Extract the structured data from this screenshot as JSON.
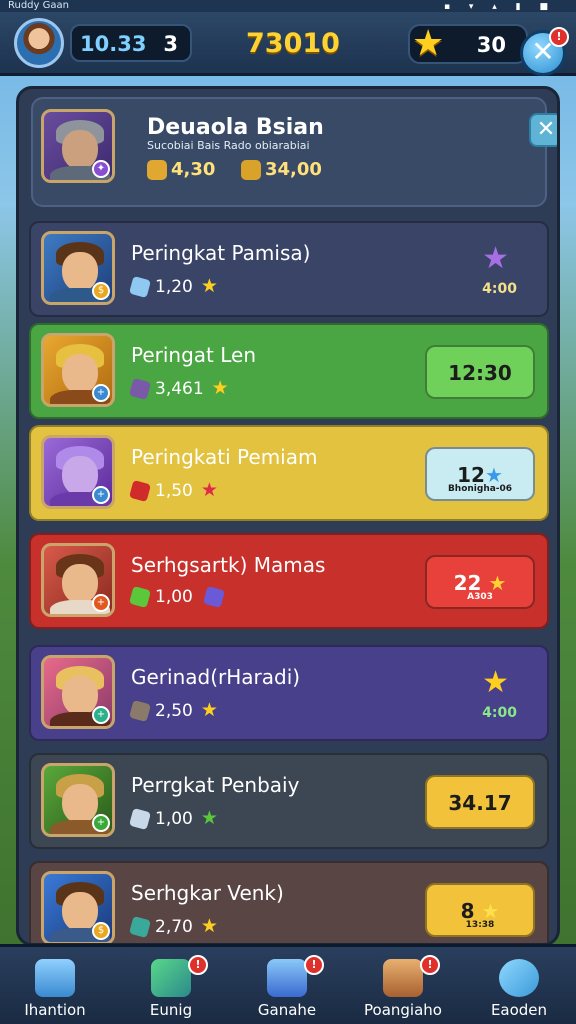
{
  "status_bar": {
    "title": "Ruddy Gaan"
  },
  "top_bar": {
    "player_level": "10.33",
    "player_rank": "3",
    "score": "73010",
    "coins": "30",
    "close_icon": "close-icon"
  },
  "panel": {
    "header": {
      "title": "Deuaola Bsian",
      "subtitle": "Sucobiai Bais Rado obiarabiai",
      "res1": "4,30",
      "res2": "34,00"
    },
    "rows": [
      {
        "name": "Peringkat Pamisa)",
        "stat": "1,20",
        "right_value": "4:00",
        "style": "star"
      },
      {
        "name": "Peringat Len",
        "stat": "3,461",
        "button_label": "12:30",
        "style": "green-button"
      },
      {
        "name": "Peringkati Pemiam",
        "stat": "1,50",
        "button_label": "12",
        "button_sub": "Bhonigha-06",
        "style": "light-button"
      },
      {
        "name": "Serhgsartk) Mamas",
        "stat": "1,00",
        "button_label": "22",
        "button_sub": "A303",
        "style": "red-button"
      },
      {
        "name": "Gerinad(rHaradi)",
        "stat": "2,50",
        "right_value": "4:00",
        "style": "star"
      },
      {
        "name": "Perrgkat Penbaiy",
        "stat": "1,00",
        "button_label": "34.17",
        "style": "gold-button"
      },
      {
        "name": "Serhgkar Venk)",
        "stat": "2,70",
        "button_label": "8",
        "button_sub": "13:38",
        "style": "gold-star-button"
      }
    ]
  },
  "bottom_nav": [
    {
      "label": "Ihantion",
      "icon": "home-icon"
    },
    {
      "label": "Eunig",
      "icon": "gem-icon"
    },
    {
      "label": "Ganahe",
      "icon": "document-icon"
    },
    {
      "label": "Poangiaho",
      "icon": "chest-icon"
    },
    {
      "label": "Eaoden",
      "icon": "key-icon"
    }
  ],
  "colors": {
    "accent_gold": "#ffd233",
    "row_dark": "#3a4466",
    "row_green": "#4aa543",
    "row_yellow": "#e2c23e",
    "row_red": "#c8302b",
    "row_purple": "#48408a",
    "row_slate": "#3d4753",
    "row_brown": "#5a4545"
  }
}
